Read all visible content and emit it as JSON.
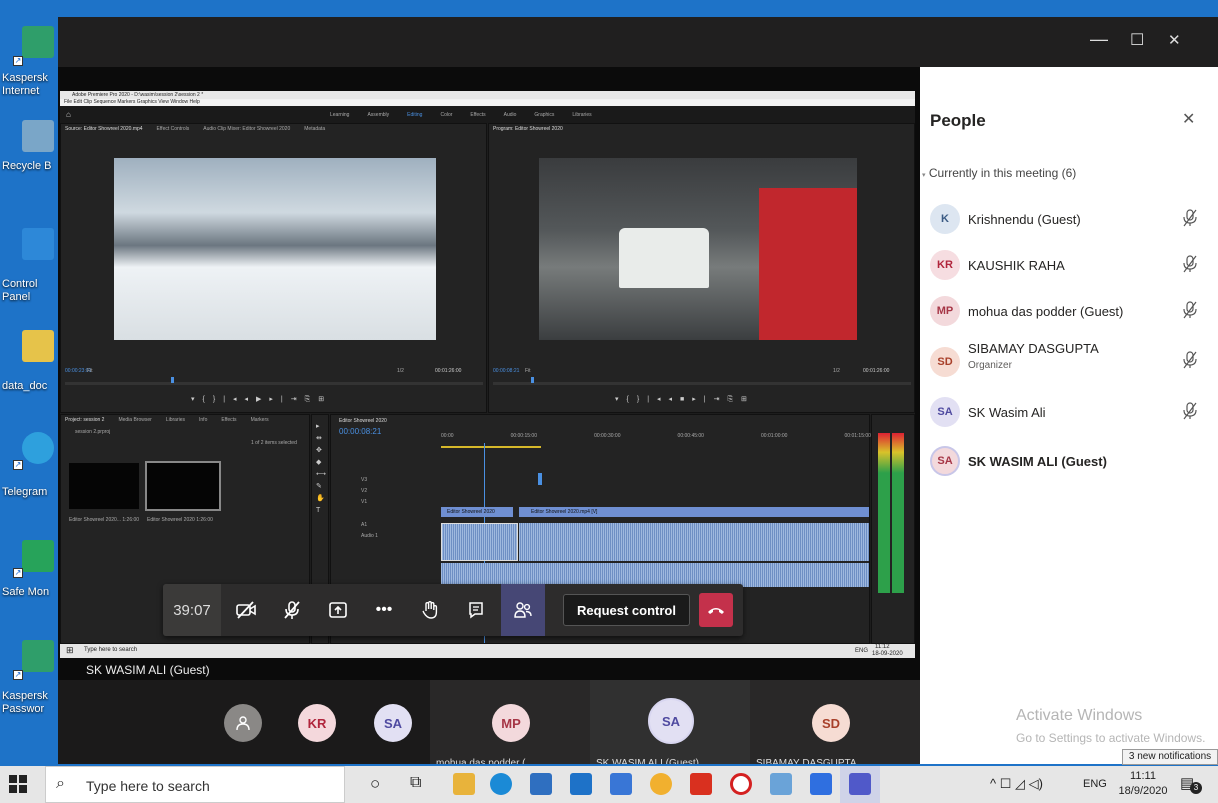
{
  "desktop": {
    "icons": [
      {
        "label": "Kaspersk\nInternet",
        "color": "#2f9e6a"
      },
      {
        "label": "Recycle B",
        "color": "#7aa6c8"
      },
      {
        "label": "Control\nPanel",
        "color": "#2d88d8"
      },
      {
        "label": "data_doc",
        "color": "#e6c34a"
      },
      {
        "label": "Telegram",
        "color": "#2ea0dd"
      },
      {
        "label": "Safe Mon",
        "color": "#27a35a"
      },
      {
        "label": "Kaspersk\nPasswor",
        "color": "#2f9e6a"
      }
    ]
  },
  "window": {
    "minimize": "—",
    "maximize": "☐",
    "close": "✕"
  },
  "premiere": {
    "title": "Adobe Premiere Pro 2020 - D:\\wasim\\session 2\\session 2 *",
    "menu": "File  Edit  Clip  Sequence  Markers  Graphics  View  Window  Help",
    "workspaces": [
      "Learning",
      "Assembly",
      "Editing",
      "Color",
      "Effects",
      "Audio",
      "Graphics",
      "Libraries"
    ],
    "source_tab": "Source: Editor Showreel 2020.mp4",
    "effect_controls": "Effect Controls",
    "audio_mixer": "Audio Clip Mixer: Editor Showreel 2020",
    "metadata": "Metadata",
    "program_tab": "Program: Editor Showreel 2020",
    "source_tc": "00:00:23:01",
    "source_dur": "00:01:26:00",
    "program_tc": "00:00:08:21",
    "program_dur": "00:01:26:00",
    "fit": "Fit",
    "ratio": "1/2",
    "project_tab": "Project: session 2",
    "media_browser": "Media Browser",
    "libraries": "Libraries",
    "info": "Info",
    "effects": "Effects",
    "markers": "Markers",
    "project_file": "session 2.prproj",
    "items_selected": "1 of 2 items selected",
    "clip1": "Editor Showreel 2020...  1:26:00",
    "clip2": "Editor Showreel 2020   1:26:00",
    "seq_tab": "Editor Showreel 2020",
    "seq_tc": "00:00:08:21",
    "ruler": [
      "00:00",
      "00:00:15:00",
      "00:00:30:00",
      "00:00:45:00",
      "00:01:00:00",
      "00:01:15:00"
    ],
    "tracks": [
      "V3",
      "V2",
      "V1",
      "A1"
    ],
    "audio_label": "Audio 1",
    "clip_v1a": "Editor Showreel 2020",
    "clip_v1b": "Editor Showreel 2020.mp4 [V]",
    "taskbar_search": "Type here to search",
    "taskbar_time": "11:12",
    "taskbar_date": "18-09-2020",
    "taskbar_lang": "ENG",
    "presenter_name": "SK WASIM ALI (Guest)"
  },
  "controls": {
    "timer": "39:07",
    "request_control": "Request control",
    "icons": [
      "camera-off-icon",
      "mic-off-icon",
      "share-tray-icon",
      "more-icon",
      "raise-hand-icon",
      "chat-icon",
      "participants-icon",
      "hang-up-icon"
    ]
  },
  "strip": [
    {
      "initials": "",
      "name": "",
      "bg": "#8a8886",
      "fg": "#ffffff"
    },
    {
      "initials": "KR",
      "name": "",
      "bg": "#f4d8dc",
      "fg": "#b0253c"
    },
    {
      "initials": "SA",
      "name": "",
      "bg": "#e2e0f3",
      "fg": "#4f4aa0"
    },
    {
      "initials": "MP",
      "name": "mohua das podder (",
      "bg": "#f3d9dc",
      "fg": "#a63646"
    },
    {
      "initials": "SA",
      "name": "SK WASIM ALI (Guest)",
      "bg": "#e2e0f3",
      "fg": "#4f4aa0"
    },
    {
      "initials": "SD",
      "name": "SIBAMAY DASGUPTA",
      "bg": "#f6dcd3",
      "fg": "#a8402a"
    }
  ],
  "people": {
    "title": "People",
    "section": "Currently in this meeting (6)",
    "members": [
      {
        "initials": "K",
        "name": "Krishnendu (Guest)",
        "sub": "",
        "bg": "#dde6f1",
        "fg": "#3b5b84",
        "bold": false,
        "muted": true
      },
      {
        "initials": "KR",
        "name": "KAUSHIK RAHA",
        "sub": "",
        "bg": "#f6dde1",
        "fg": "#b0253c",
        "bold": false,
        "muted": true
      },
      {
        "initials": "MP",
        "name": "mohua das podder (Guest)",
        "sub": "",
        "bg": "#f3d9dc",
        "fg": "#a63646",
        "bold": false,
        "muted": true
      },
      {
        "initials": "SD",
        "name": "SIBAMAY DASGUPTA",
        "sub": "Organizer",
        "bg": "#f6dcd3",
        "fg": "#a8402a",
        "bold": false,
        "muted": true
      },
      {
        "initials": "SA",
        "name": "SK Wasim Ali",
        "sub": "",
        "bg": "#e2e0f3",
        "fg": "#4f4aa0",
        "bold": false,
        "muted": true
      },
      {
        "initials": "SA",
        "name": "SK WASIM ALI (Guest)",
        "sub": "",
        "bg": "#f3d9dc",
        "fg": "#a63646",
        "bold": true,
        "muted": false
      }
    ],
    "activate_title": "Activate Windows",
    "activate_sub": "Go to Settings to activate Windows."
  },
  "notification": "3 new notifications",
  "taskbar": {
    "search_placeholder": "Type here to search",
    "lang": "ENG",
    "time": "11:11",
    "date": "18/9/2020",
    "badge": "3"
  }
}
